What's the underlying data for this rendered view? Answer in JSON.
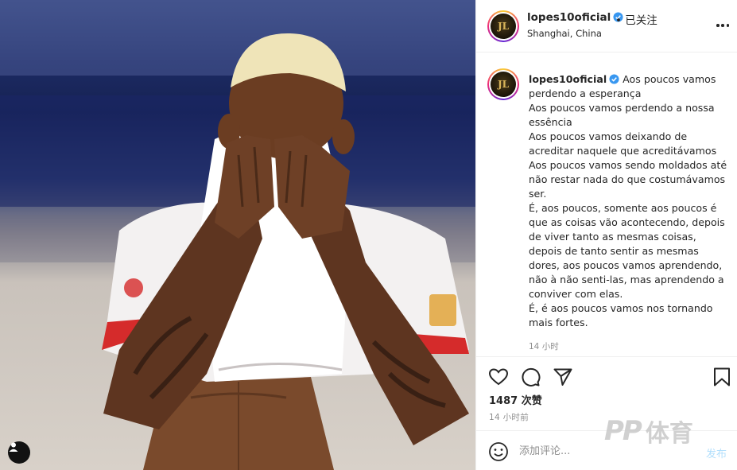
{
  "post": {
    "username": "lopes10oficial",
    "separator": "•",
    "follow_status": "已关注",
    "location": "Shanghai, China",
    "avatar_monogram": "JL",
    "verified_icon": "verified-badge-icon",
    "more_icon": "more-options-icon"
  },
  "caption": {
    "username": "lopes10oficial",
    "text": "Aos poucos vamos perdendo a esperança\nAos poucos vamos perdendo a nossa essência\nAos poucos vamos deixando de acreditar naquele que acreditávamos\nAos poucos vamos sendo moldados até não restar nada do que costumávamos ser.\nÉ, aos poucos, somente aos poucos é que as coisas vão acontecendo, depois de viver tanto as mesmas coisas, depois de tanto sentir as mesmas dores, aos poucos vamos aprendendo, não à não senti-las, mas aprendendo a conviver com elas.\nÉ, é aos poucos vamos nos tornando mais fortes.",
    "timestamp": "14 小时"
  },
  "actions": {
    "like_icon": "heart-icon",
    "comment_icon": "comment-bubble-icon",
    "share_icon": "paper-plane-icon",
    "save_icon": "bookmark-icon",
    "likes_text": "1487 次赞",
    "posted_time": "14 小时前"
  },
  "comment": {
    "placeholder": "添加评论...",
    "post_label": "发布",
    "emoji_icon": "emoji-icon"
  },
  "photo": {
    "tag_icon": "user-tag-icon"
  },
  "watermark": {
    "mark": "PP",
    "text": "体育"
  },
  "colors": {
    "verified": "#3897f0",
    "post_button": "#b2dffc",
    "secondary_text": "#8e8e8e"
  }
}
